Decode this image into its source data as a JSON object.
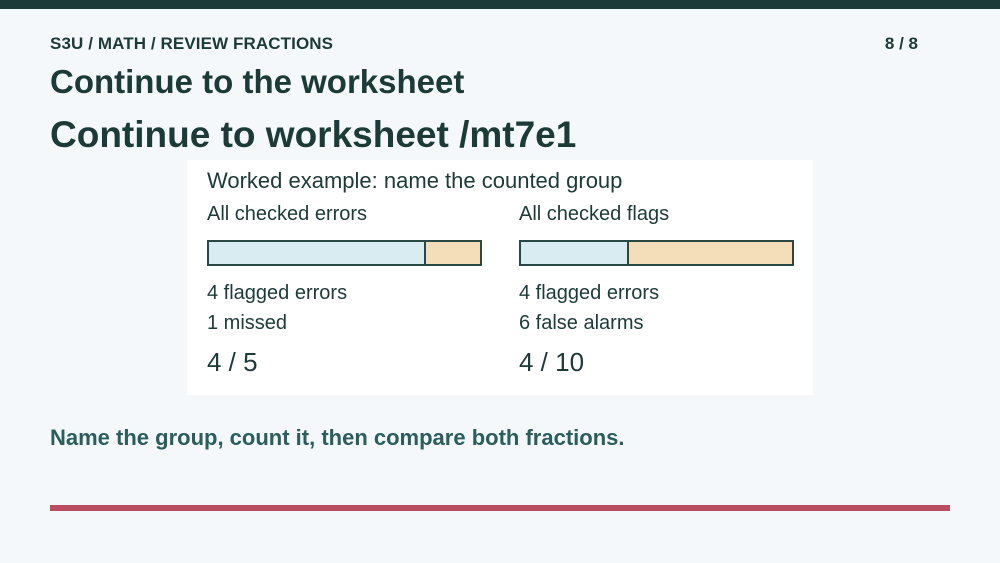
{
  "header": {
    "breadcrumb": "S3U / MATH / REVIEW FRACTIONS",
    "page_counter": "8 / 8",
    "title": "Continue to the worksheet",
    "subtitle": "Continue to worksheet /mt7e1"
  },
  "example": {
    "heading": "Worked example: name the counted group",
    "left": {
      "label": "All checked errors",
      "bar_fraction": 0.8,
      "line1": "4 flagged errors",
      "line2": "1 missed",
      "fraction": "4 / 5"
    },
    "right": {
      "label": "All checked flags",
      "bar_fraction": 0.4,
      "line1": "4 flagged errors",
      "line2": "6 false alarms",
      "fraction": "4 / 10"
    }
  },
  "instruction": "Name the group, count it, then compare both fractions.",
  "colors": {
    "top_bar": "#1c3a38",
    "counted_segment": "#d8ecf2",
    "other_segment": "#f3deb9",
    "bottom_rule": "#b94d62"
  }
}
